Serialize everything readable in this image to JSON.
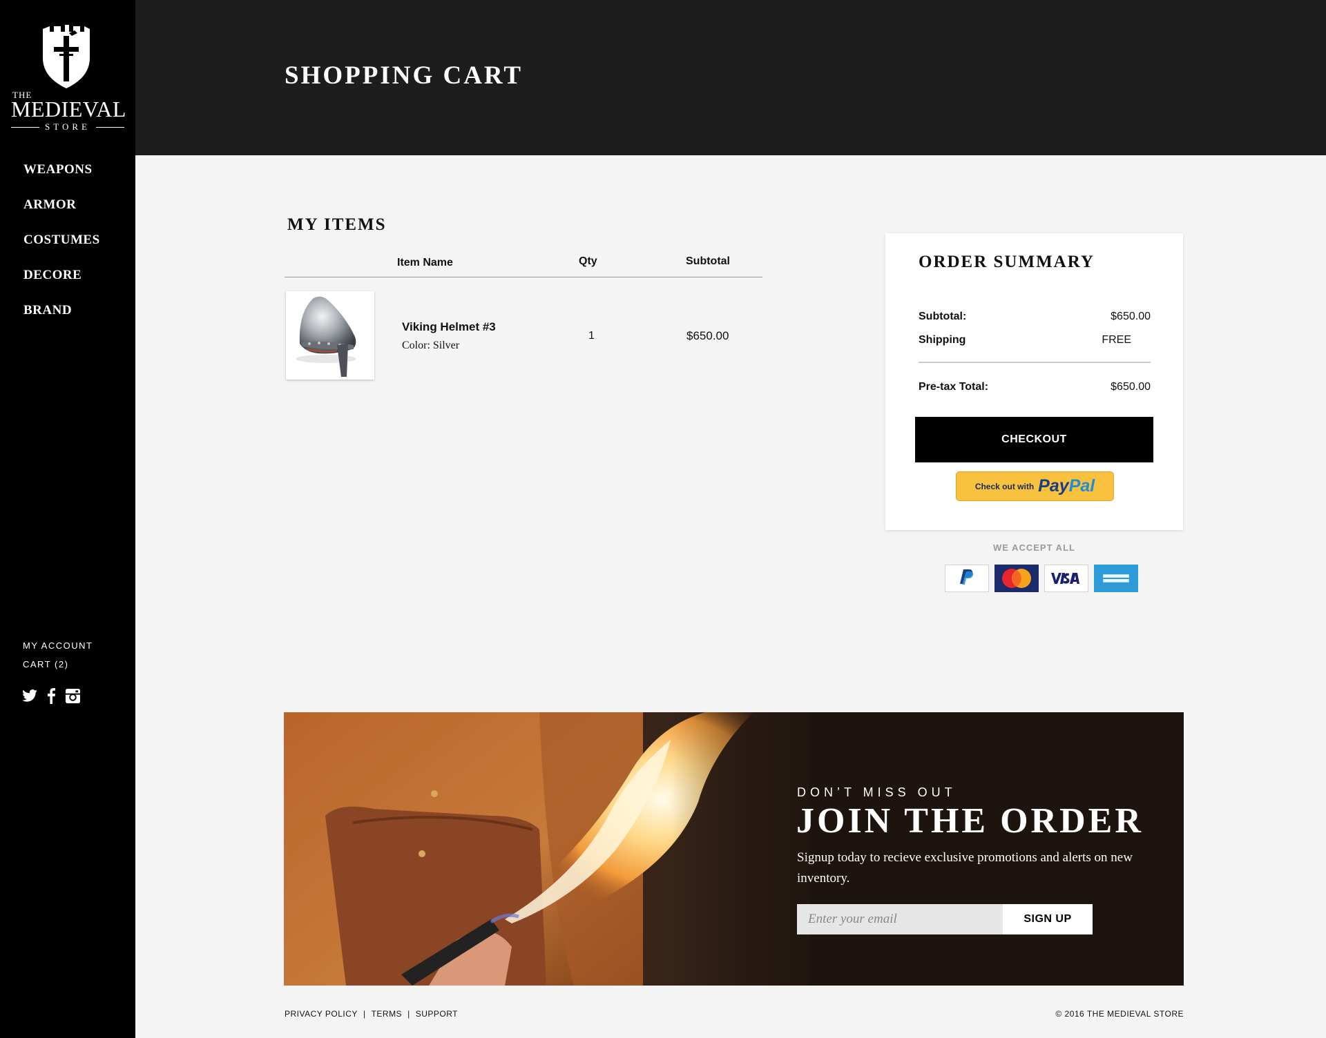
{
  "brand": {
    "the": "THE",
    "name": "MEDIEVAL",
    "store": "STORE"
  },
  "nav": {
    "items": [
      {
        "label": "WEAPONS"
      },
      {
        "label": "ARMOR"
      },
      {
        "label": "COSTUMES"
      },
      {
        "label": "DECORE"
      },
      {
        "label": "BRAND"
      }
    ]
  },
  "account": {
    "my_account": "MY ACCOUNT",
    "cart": "CART (2)"
  },
  "social": [
    "twitter-icon",
    "facebook-icon",
    "instagram-icon"
  ],
  "header": {
    "title": "SHOPPING CART"
  },
  "items": {
    "heading": "MY ITEMS",
    "columns": {
      "name": "Item Name",
      "qty": "Qty",
      "subtotal": "Subtotal"
    },
    "rows": [
      {
        "name": "Viking Helmet #3",
        "color": "Color: Silver",
        "qty": "1",
        "subtotal": "$650.00"
      }
    ]
  },
  "summary": {
    "title": "ORDER SUMMARY",
    "subtotal_label": "Subtotal:",
    "subtotal_value": "$650.00",
    "shipping_label": "Shipping",
    "shipping_value": "FREE",
    "total_label": "Pre-tax Total:",
    "total_value": "$650.00",
    "checkout_label": "CHECKOUT",
    "paypal_prefix": "Check out with",
    "paypal_word1": "Pay",
    "paypal_word2": "Pal"
  },
  "payments": {
    "label": "WE ACCEPT ALL",
    "cards": [
      "paypal-card-icon",
      "mastercard-card-icon",
      "visa-card-icon",
      "amex-card-icon"
    ]
  },
  "banner": {
    "kicker": "DON’T MISS OUT",
    "title": "JOIN THE ORDER",
    "text": "Signup today to recieve exclusive promotions and alerts on new inventory.",
    "email_placeholder": "Enter your email",
    "signup_label": "SIGN UP"
  },
  "footer": {
    "privacy": "PRIVACY POLICY",
    "terms": "TERMS",
    "support": "SUPPORT",
    "separator": "|",
    "copyright": "© 2016 THE MEDIEVAL STORE"
  },
  "colors": {
    "sidebar": "#000000",
    "header": "#1d1d1d",
    "page": "#f4f4f4",
    "paypal_yellow": "#f8c13e",
    "banner_dark": "#1e140f"
  }
}
